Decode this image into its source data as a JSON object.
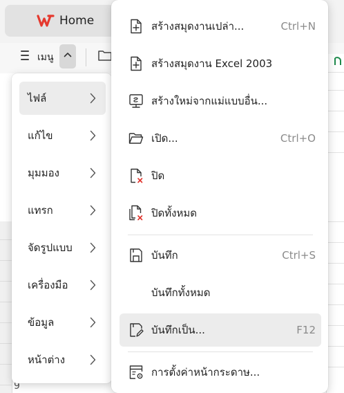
{
  "tab": {
    "title": "Home",
    "logo": "WPS-logo"
  },
  "toolbar": {
    "menu_label": "เมนู",
    "menu_icon": "hamburger-icon",
    "folder_icon": "folder-icon"
  },
  "sheet": {
    "row_number": "9",
    "accent_color": "#1e8a4c"
  },
  "left_menu": {
    "items": [
      {
        "label": "ไฟล์",
        "active": true
      },
      {
        "label": "แก้ไข"
      },
      {
        "label": "มุมมอง"
      },
      {
        "label": "แทรก"
      },
      {
        "label": "จัดรูปแบบ"
      },
      {
        "label": "เครื่องมือ"
      },
      {
        "label": "ข้อมูล"
      },
      {
        "label": "หน้าต่าง"
      }
    ]
  },
  "file_menu": {
    "items": [
      {
        "label": "สร้างสมุดงานเปล่า...",
        "shortcut": "Ctrl+N",
        "icon": "new-workbook-icon"
      },
      {
        "label": "สร้างสมุดงาน Excel 2003",
        "shortcut": "",
        "icon": "new-excel2003-icon"
      },
      {
        "label": "สร้างใหม่จากแม่แบบอื่น...",
        "shortcut": "",
        "icon": "template-icon"
      },
      {
        "label": "เปิด...",
        "shortcut": "Ctrl+O",
        "icon": "open-folder-icon"
      },
      {
        "label": "ปิด",
        "shortcut": "",
        "icon": "close-file-icon"
      },
      {
        "label": "ปิดทั้งหมด",
        "shortcut": "",
        "icon": "close-all-icon"
      },
      {
        "label": "บันทึก",
        "shortcut": "Ctrl+S",
        "icon": "save-icon"
      },
      {
        "label": "บันทึกทั้งหมด",
        "shortcut": "",
        "icon": ""
      },
      {
        "label": "บันทึกเป็น...",
        "shortcut": "F12",
        "icon": "save-as-icon",
        "active": true
      },
      {
        "label": "การตั้งค่าหน้ากระดาษ...",
        "shortcut": "",
        "icon": "page-setup-icon"
      }
    ]
  },
  "colors": {
    "close_red": "#e0322b",
    "hover": "#ececec",
    "shortcut_gray": "#8a8a8a"
  }
}
